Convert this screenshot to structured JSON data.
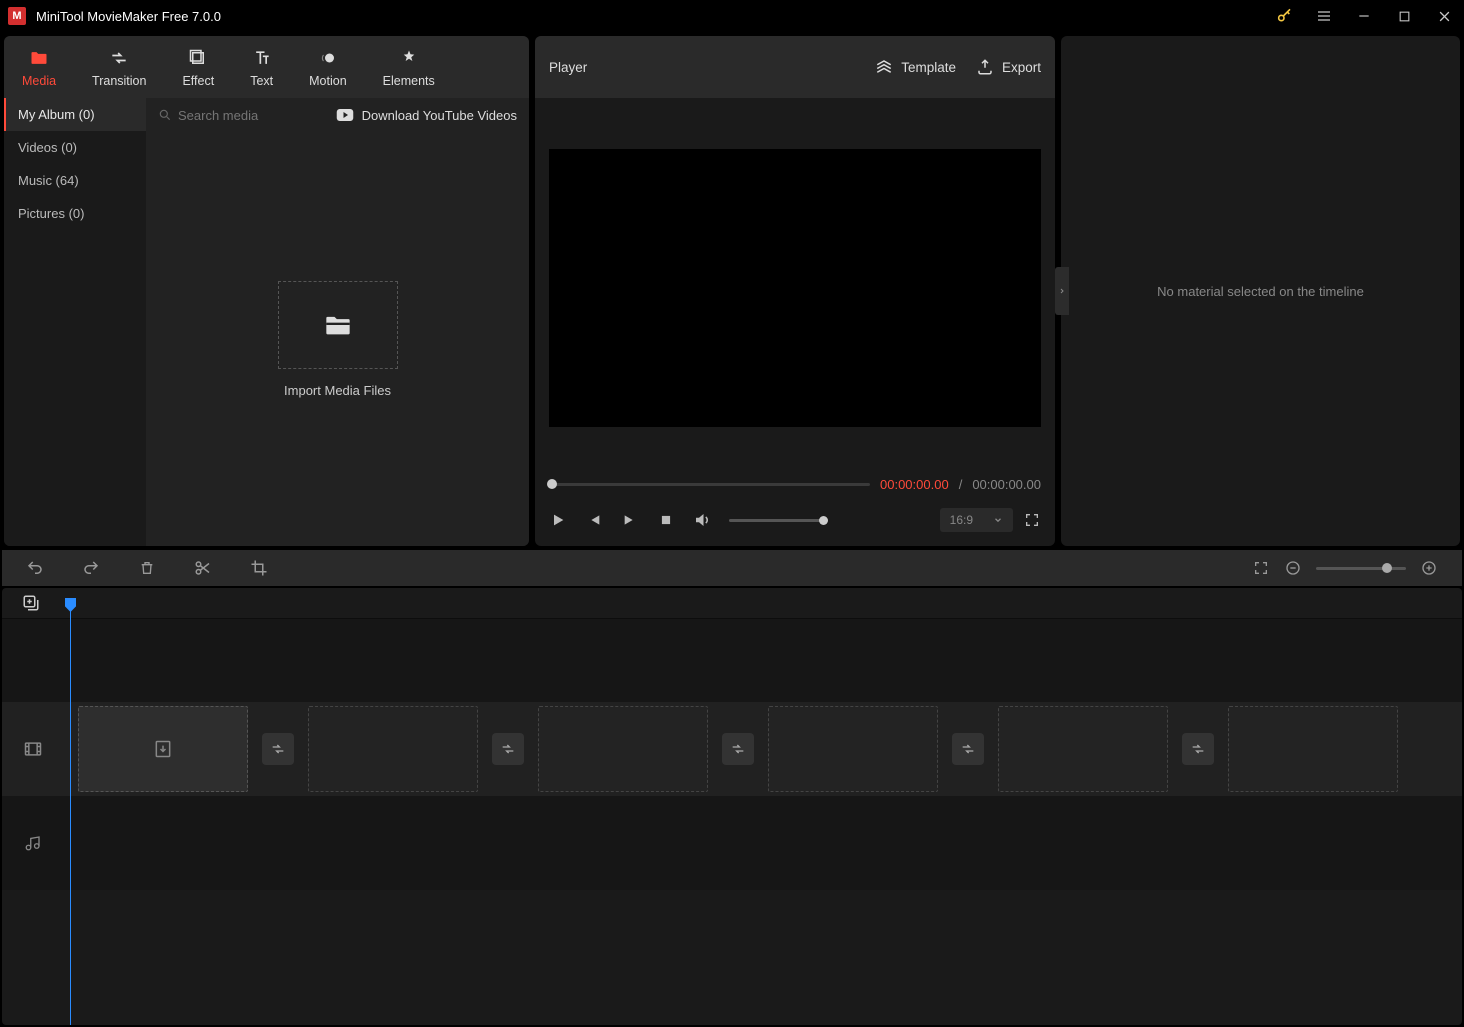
{
  "titlebar": {
    "title": "MiniTool MovieMaker Free 7.0.0"
  },
  "tabs": {
    "media": "Media",
    "transition": "Transition",
    "effect": "Effect",
    "text": "Text",
    "motion": "Motion",
    "elements": "Elements"
  },
  "sidebar": {
    "my_album": "My Album (0)",
    "videos": "Videos (0)",
    "music": "Music (64)",
    "pictures": "Pictures (0)"
  },
  "media_area": {
    "search_placeholder": "Search media",
    "download_youtube": "Download YouTube Videos",
    "import_label": "Import Media Files"
  },
  "player": {
    "title": "Player",
    "template": "Template",
    "export": "Export",
    "time_current": "00:00:00.00",
    "time_sep": "/",
    "time_total": "00:00:00.00",
    "ratio": "16:9"
  },
  "properties": {
    "empty_message": "No material selected on the timeline"
  }
}
